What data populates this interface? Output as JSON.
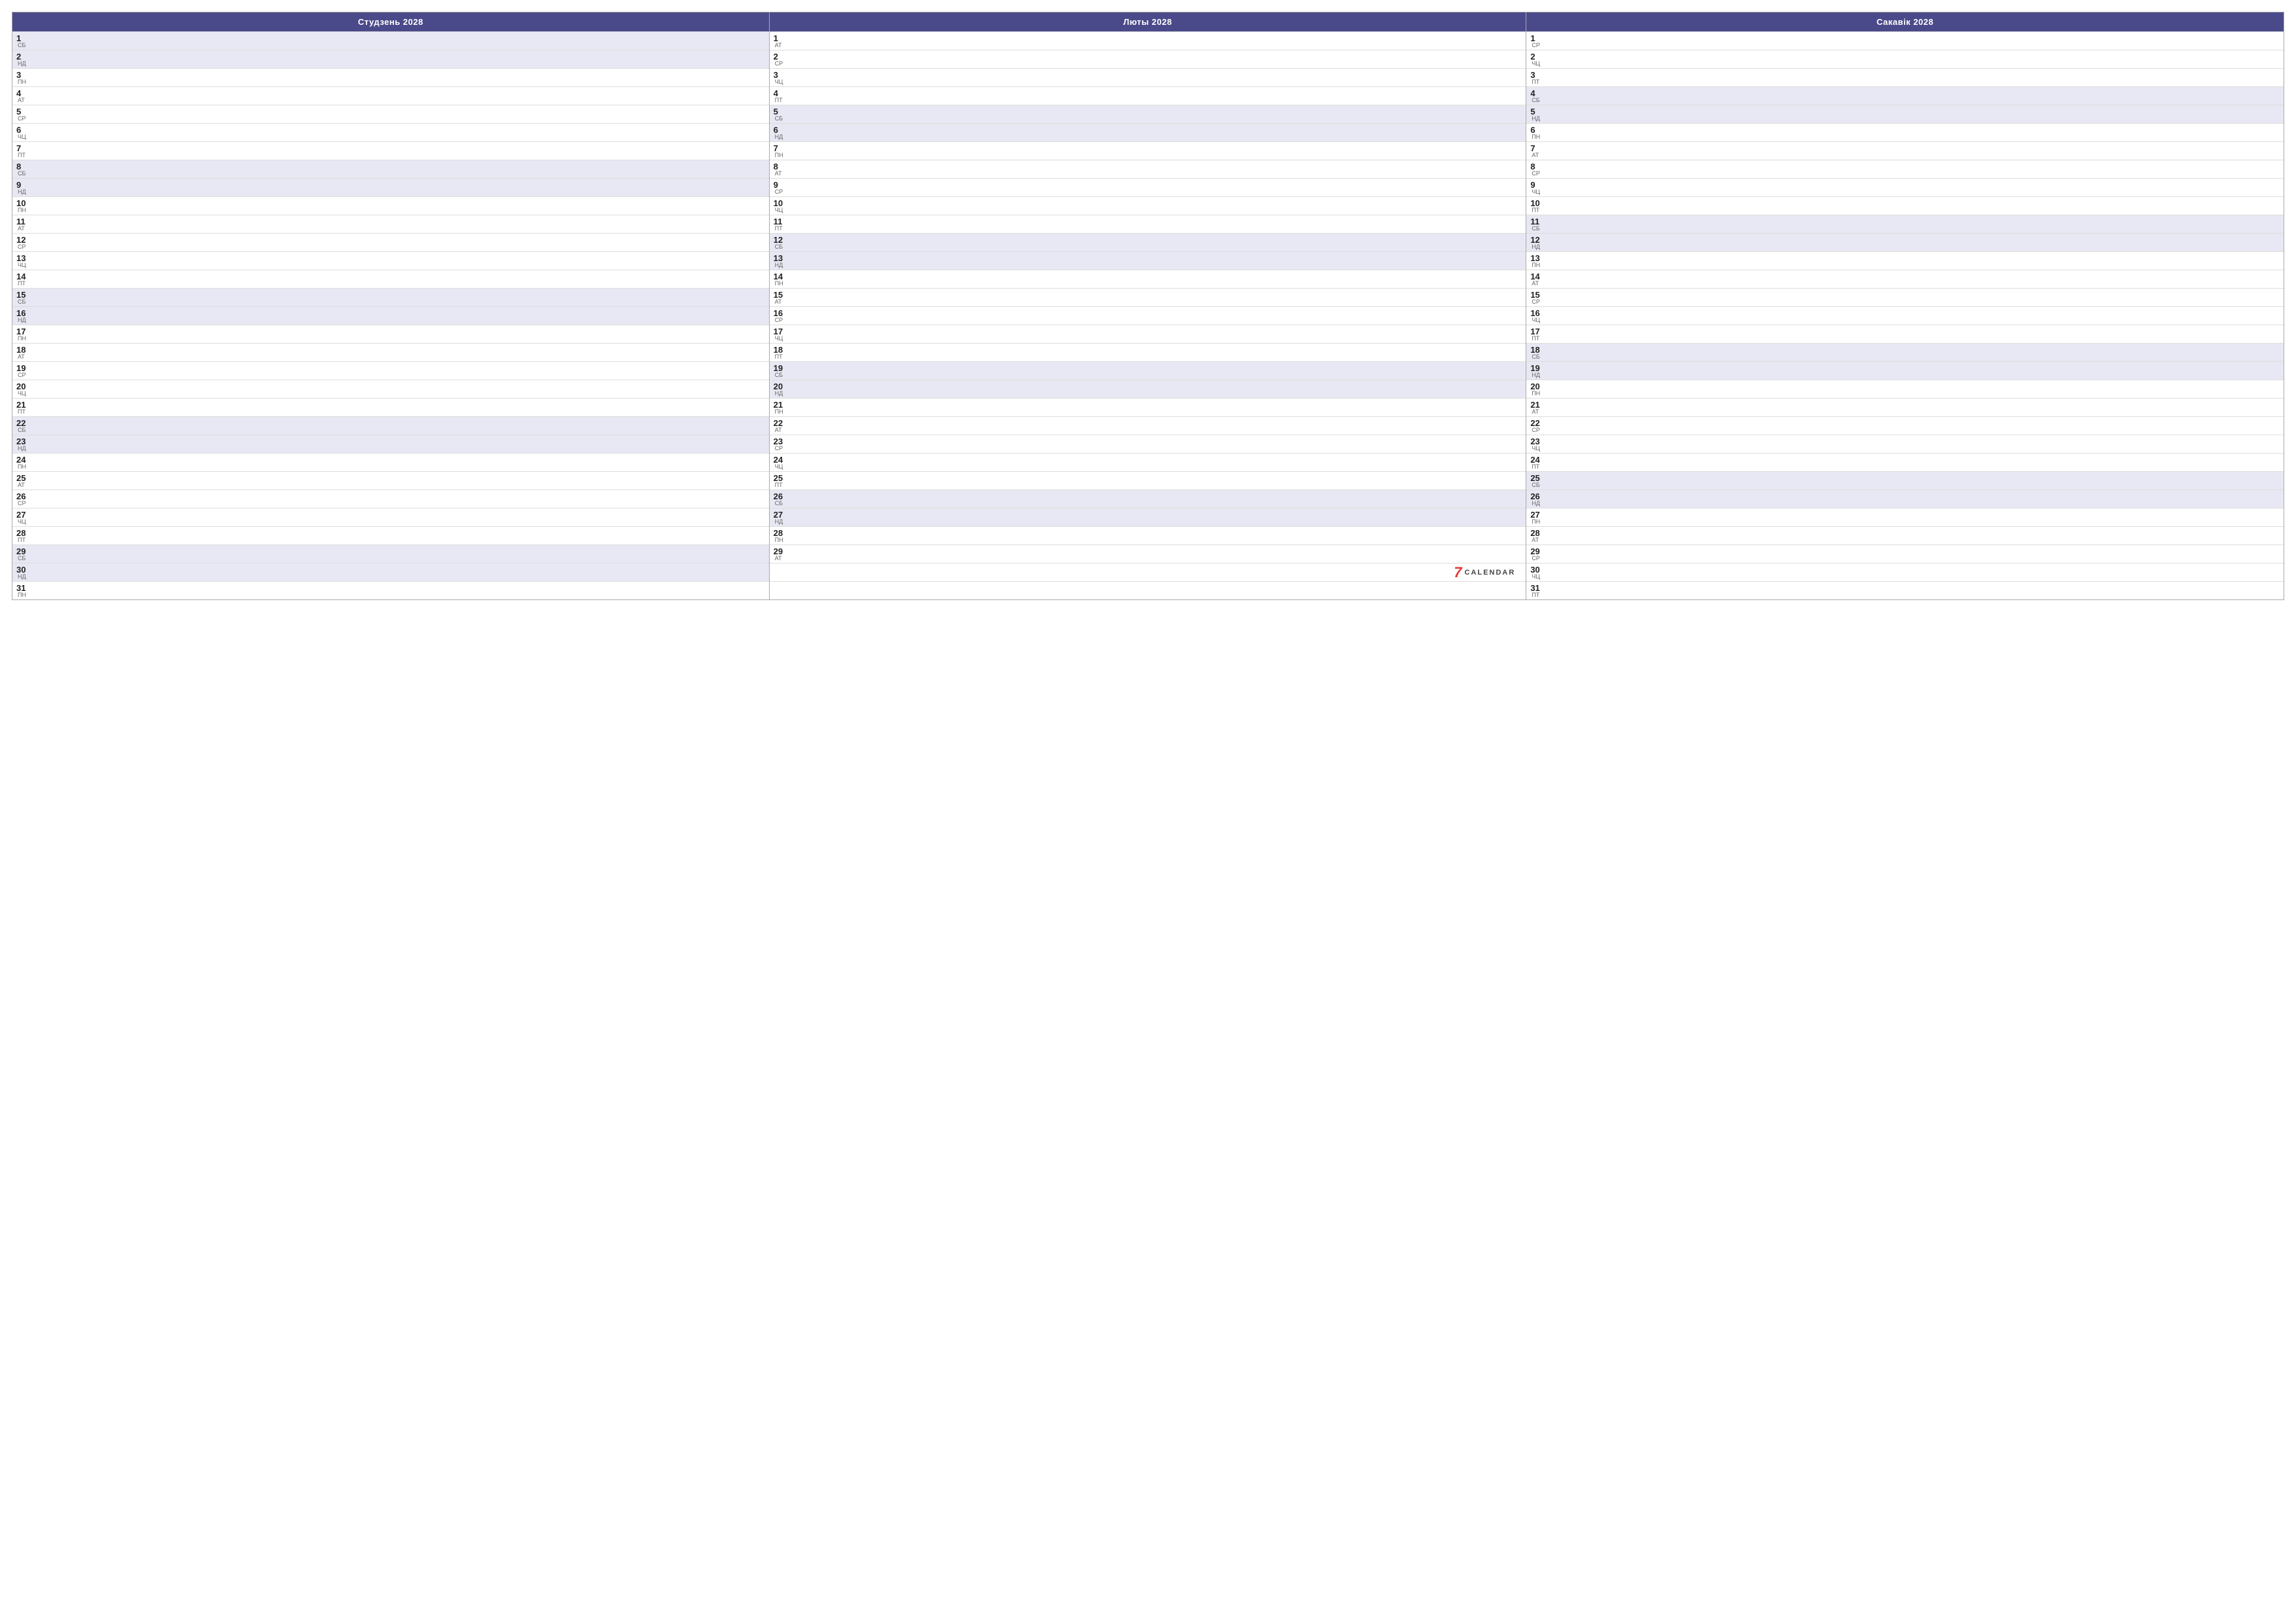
{
  "months": [
    {
      "name": "Студзень 2028",
      "days": [
        {
          "num": "1",
          "name": "СБ",
          "weekend": true
        },
        {
          "num": "2",
          "name": "НД",
          "weekend": true
        },
        {
          "num": "3",
          "name": "ПН",
          "weekend": false
        },
        {
          "num": "4",
          "name": "АТ",
          "weekend": false
        },
        {
          "num": "5",
          "name": "СР",
          "weekend": false
        },
        {
          "num": "6",
          "name": "ЧЦ",
          "weekend": false
        },
        {
          "num": "7",
          "name": "ПТ",
          "weekend": false
        },
        {
          "num": "8",
          "name": "СБ",
          "weekend": true
        },
        {
          "num": "9",
          "name": "НД",
          "weekend": true
        },
        {
          "num": "10",
          "name": "ПН",
          "weekend": false
        },
        {
          "num": "11",
          "name": "АТ",
          "weekend": false
        },
        {
          "num": "12",
          "name": "СР",
          "weekend": false
        },
        {
          "num": "13",
          "name": "ЧЦ",
          "weekend": false
        },
        {
          "num": "14",
          "name": "ПТ",
          "weekend": false
        },
        {
          "num": "15",
          "name": "СБ",
          "weekend": true
        },
        {
          "num": "16",
          "name": "НД",
          "weekend": true
        },
        {
          "num": "17",
          "name": "ПН",
          "weekend": false
        },
        {
          "num": "18",
          "name": "АТ",
          "weekend": false
        },
        {
          "num": "19",
          "name": "СР",
          "weekend": false
        },
        {
          "num": "20",
          "name": "ЧЦ",
          "weekend": false
        },
        {
          "num": "21",
          "name": "ПТ",
          "weekend": false
        },
        {
          "num": "22",
          "name": "СБ",
          "weekend": true
        },
        {
          "num": "23",
          "name": "НД",
          "weekend": true
        },
        {
          "num": "24",
          "name": "ПН",
          "weekend": false
        },
        {
          "num": "25",
          "name": "АТ",
          "weekend": false
        },
        {
          "num": "26",
          "name": "СР",
          "weekend": false
        },
        {
          "num": "27",
          "name": "ЧЦ",
          "weekend": false
        },
        {
          "num": "28",
          "name": "ПТ",
          "weekend": false
        },
        {
          "num": "29",
          "name": "СБ",
          "weekend": true
        },
        {
          "num": "30",
          "name": "НД",
          "weekend": true
        },
        {
          "num": "31",
          "name": "ПН",
          "weekend": false
        }
      ]
    },
    {
      "name": "Люты 2028",
      "days": [
        {
          "num": "1",
          "name": "АТ",
          "weekend": false
        },
        {
          "num": "2",
          "name": "СР",
          "weekend": false
        },
        {
          "num": "3",
          "name": "ЧЦ",
          "weekend": false
        },
        {
          "num": "4",
          "name": "ПТ",
          "weekend": false
        },
        {
          "num": "5",
          "name": "СБ",
          "weekend": true
        },
        {
          "num": "6",
          "name": "НД",
          "weekend": true
        },
        {
          "num": "7",
          "name": "ПН",
          "weekend": false
        },
        {
          "num": "8",
          "name": "АТ",
          "weekend": false
        },
        {
          "num": "9",
          "name": "СР",
          "weekend": false
        },
        {
          "num": "10",
          "name": "ЧЦ",
          "weekend": false
        },
        {
          "num": "11",
          "name": "ПТ",
          "weekend": false
        },
        {
          "num": "12",
          "name": "СБ",
          "weekend": true
        },
        {
          "num": "13",
          "name": "НД",
          "weekend": true
        },
        {
          "num": "14",
          "name": "ПН",
          "weekend": false
        },
        {
          "num": "15",
          "name": "АТ",
          "weekend": false
        },
        {
          "num": "16",
          "name": "СР",
          "weekend": false
        },
        {
          "num": "17",
          "name": "ЧЦ",
          "weekend": false
        },
        {
          "num": "18",
          "name": "ПТ",
          "weekend": false
        },
        {
          "num": "19",
          "name": "СБ",
          "weekend": true
        },
        {
          "num": "20",
          "name": "НД",
          "weekend": true
        },
        {
          "num": "21",
          "name": "ПН",
          "weekend": false
        },
        {
          "num": "22",
          "name": "АТ",
          "weekend": false
        },
        {
          "num": "23",
          "name": "СР",
          "weekend": false
        },
        {
          "num": "24",
          "name": "ЧЦ",
          "weekend": false
        },
        {
          "num": "25",
          "name": "ПТ",
          "weekend": false
        },
        {
          "num": "26",
          "name": "СБ",
          "weekend": true
        },
        {
          "num": "27",
          "name": "НД",
          "weekend": true
        },
        {
          "num": "28",
          "name": "ПН",
          "weekend": false
        },
        {
          "num": "29",
          "name": "АТ",
          "weekend": false
        }
      ]
    },
    {
      "name": "Сакавік 2028",
      "days": [
        {
          "num": "1",
          "name": "СР",
          "weekend": false
        },
        {
          "num": "2",
          "name": "ЧЦ",
          "weekend": false
        },
        {
          "num": "3",
          "name": "ПТ",
          "weekend": false
        },
        {
          "num": "4",
          "name": "СБ",
          "weekend": true
        },
        {
          "num": "5",
          "name": "НД",
          "weekend": true
        },
        {
          "num": "6",
          "name": "ПН",
          "weekend": false
        },
        {
          "num": "7",
          "name": "АТ",
          "weekend": false
        },
        {
          "num": "8",
          "name": "СР",
          "weekend": false
        },
        {
          "num": "9",
          "name": "ЧЦ",
          "weekend": false
        },
        {
          "num": "10",
          "name": "ПТ",
          "weekend": false
        },
        {
          "num": "11",
          "name": "СБ",
          "weekend": true
        },
        {
          "num": "12",
          "name": "НД",
          "weekend": true
        },
        {
          "num": "13",
          "name": "ПН",
          "weekend": false
        },
        {
          "num": "14",
          "name": "АТ",
          "weekend": false
        },
        {
          "num": "15",
          "name": "СР",
          "weekend": false
        },
        {
          "num": "16",
          "name": "ЧЦ",
          "weekend": false
        },
        {
          "num": "17",
          "name": "ПТ",
          "weekend": false
        },
        {
          "num": "18",
          "name": "СБ",
          "weekend": true
        },
        {
          "num": "19",
          "name": "НД",
          "weekend": true
        },
        {
          "num": "20",
          "name": "ПН",
          "weekend": false
        },
        {
          "num": "21",
          "name": "АТ",
          "weekend": false
        },
        {
          "num": "22",
          "name": "СР",
          "weekend": false
        },
        {
          "num": "23",
          "name": "ЧЦ",
          "weekend": false
        },
        {
          "num": "24",
          "name": "ПТ",
          "weekend": false
        },
        {
          "num": "25",
          "name": "СБ",
          "weekend": true
        },
        {
          "num": "26",
          "name": "НД",
          "weekend": true
        },
        {
          "num": "27",
          "name": "ПН",
          "weekend": false
        },
        {
          "num": "28",
          "name": "АТ",
          "weekend": false
        },
        {
          "num": "29",
          "name": "СР",
          "weekend": false
        },
        {
          "num": "30",
          "name": "ЧЦ",
          "weekend": false
        },
        {
          "num": "31",
          "name": "ПТ",
          "weekend": false
        }
      ]
    }
  ],
  "logo": {
    "seven": "7",
    "text": "CALENDAR"
  }
}
